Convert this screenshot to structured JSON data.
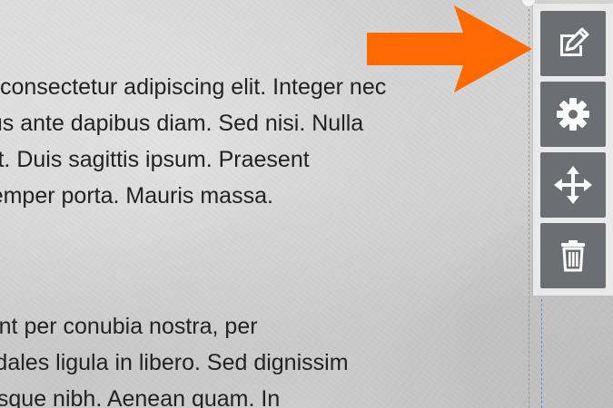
{
  "paragraphs": [
    {
      "lines": [
        "consectetur adipiscing elit. Integer nec",
        "odio. Praesent libero. Sed cursus ante dapibus diam. Sed nisi. Nulla",
        "quis sem at nibh elementum imperdiet. Duis sagittis ipsum. Praesent",
        "mauris. Fusce nec tellus sed augue semper porta. Mauris massa."
      ]
    },
    {
      "lines": [
        "Class aptent taciti sociosqu ad litora torquent per conubia nostra, per",
        "inceptos himenaeos. Curabitur sodales ligula in libero. Sed dignissim",
        "lacinia nunc. Curabitur tortor. Pellentesque nibh. Aenean quam. In"
      ]
    }
  ],
  "toolbar": {
    "buttons": [
      {
        "name": "edit",
        "icon": "edit-icon"
      },
      {
        "name": "settings",
        "icon": "gear-icon"
      },
      {
        "name": "move",
        "icon": "move-icon"
      },
      {
        "name": "delete",
        "icon": "trash-icon"
      }
    ]
  },
  "colors": {
    "toolbar_button": "#6c6e72",
    "icon": "#ffffff",
    "annotation_arrow": "#ff6a00",
    "text": "#222222"
  }
}
